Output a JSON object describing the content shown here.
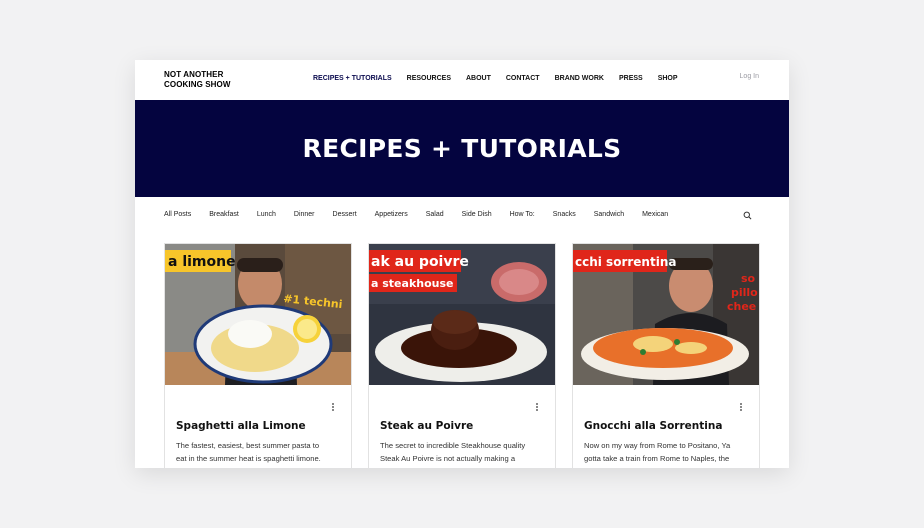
{
  "header": {
    "logo_line1": "NOT ANOTHER",
    "logo_line2": "COOKING SHOW",
    "nav": [
      "RECIPES + TUTORIALS",
      "RESOURCES",
      "ABOUT",
      "CONTACT",
      "BRAND WORK",
      "PRESS",
      "SHOP"
    ],
    "active_nav": "RECIPES + TUTORIALS",
    "login": "Log In"
  },
  "banner": {
    "title": "RECIPES + TUTORIALS"
  },
  "categories": [
    "All Posts",
    "Breakfast",
    "Lunch",
    "Dinner",
    "Dessert",
    "Appetizers",
    "Salad",
    "Side Dish",
    "How To:",
    "Snacks",
    "Sandwich",
    "Mexican"
  ],
  "posts": [
    {
      "title": "Spaghetti alla Limone",
      "excerpt_line1": "The fastest, easiest, best summer pasta to",
      "excerpt_line2": "eat in the summer heat is spaghetti limone.",
      "thumb_caption": "a limone",
      "thumb_caption2": "#1 techni"
    },
    {
      "title": "Steak au Poivre",
      "excerpt_line1": "The secret to incredible Steakhouse quality",
      "excerpt_line2": "Steak Au Poivre is not actually making a",
      "thumb_caption": "ak au poivre",
      "thumb_caption2": "a steakhouse"
    },
    {
      "title": "Gnocchi alla Sorrentina",
      "excerpt_line1": "Now on my way from Rome to Positano, Ya",
      "excerpt_line2": "gotta take a train from Rome to Naples, the",
      "thumb_caption": "cchi sorrentina",
      "thumb_caption2": "so",
      "thumb_caption3": "pillo",
      "thumb_caption4": "chee"
    }
  ],
  "colors": {
    "banner": "#04043f",
    "active_nav": "#0c0c4f",
    "caption_red": "#e0261a",
    "caption_yellow": "#f7c52a"
  }
}
